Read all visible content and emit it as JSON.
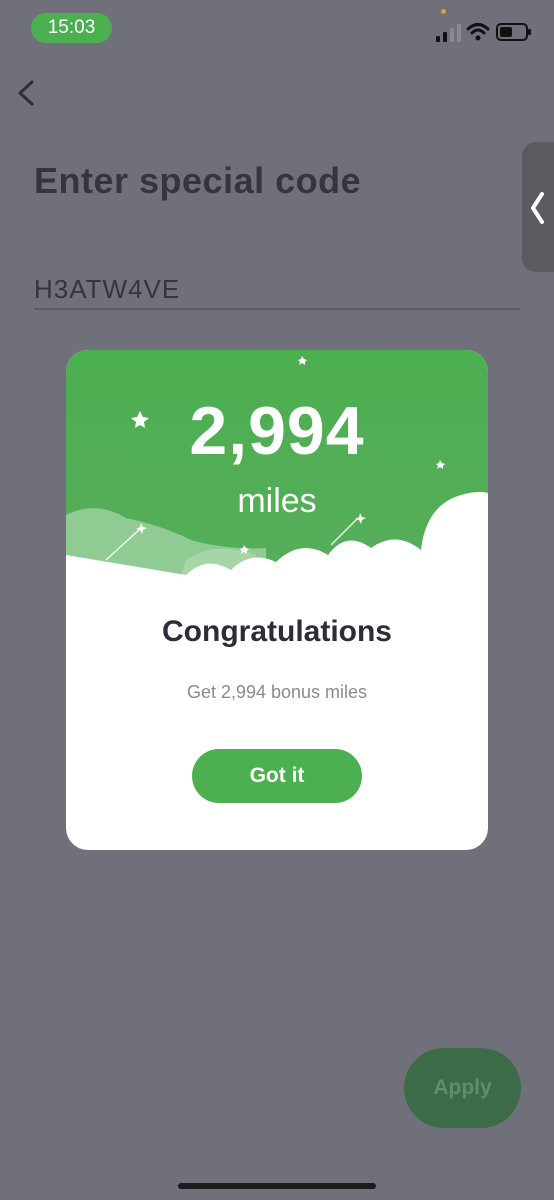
{
  "status_bar": {
    "time": "15:03",
    "icons": [
      "cellular-signal-icon",
      "wifi-icon",
      "battery-icon"
    ]
  },
  "nav": {
    "back_icon": "chevron-left-icon",
    "side_tab_icon": "chevron-left-icon"
  },
  "page": {
    "title": "Enter special code",
    "code_value": "H3ATW4VE"
  },
  "modal": {
    "miles_value": "2,994",
    "miles_unit": "miles",
    "heading": "Congratulations",
    "message": "Get 2,994 bonus miles",
    "button_label": "Got it"
  },
  "footer": {
    "apply_label": "Apply"
  },
  "colors": {
    "accent": "#4caf50",
    "overlay_bg": "#70707a",
    "title_text": "#36353f"
  }
}
